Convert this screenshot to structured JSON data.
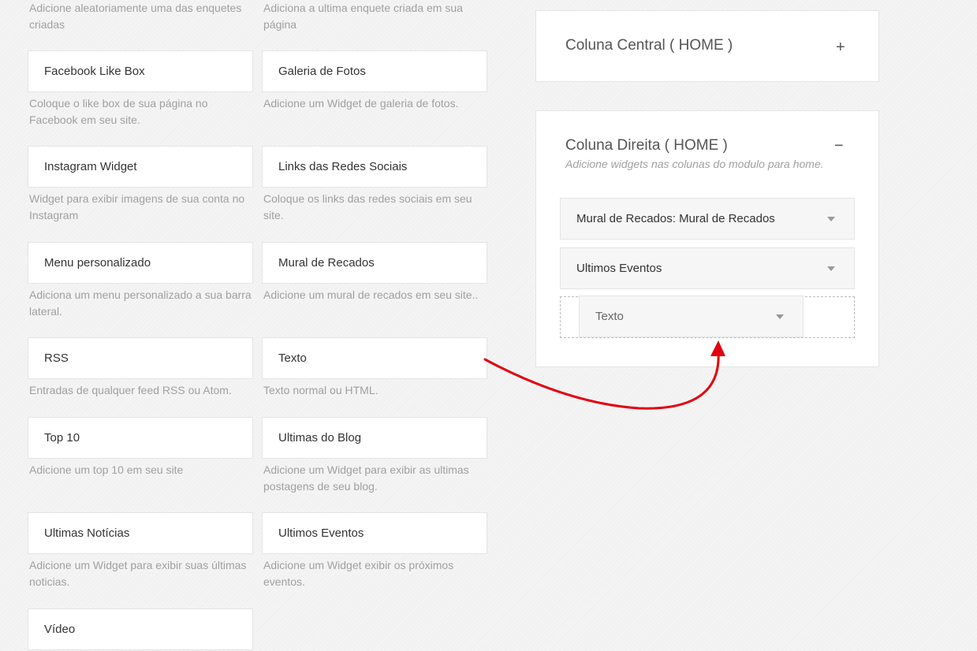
{
  "available_widgets": [
    {
      "label": "",
      "desc": "Adicione aleatoriamente uma das enquetes criadas"
    },
    {
      "label": "",
      "desc": "Adiciona a ultima enquete criada em sua página"
    },
    {
      "label": "Facebook Like Box",
      "desc": "Coloque o like box de sua página no Facebook em seu site."
    },
    {
      "label": "Galeria de Fotos",
      "desc": "Adicione um Widget de galeria de fotos."
    },
    {
      "label": "Instagram Widget",
      "desc": "Widget para exibir imagens de sua conta no Instagram"
    },
    {
      "label": "Links das Redes Sociais",
      "desc": "Coloque os links das redes sociais em seu site."
    },
    {
      "label": "Menu personalizado",
      "desc": "Adiciona um menu personalizado a sua barra lateral."
    },
    {
      "label": "Mural de Recados",
      "desc": "Adicione um mural de recados em seu site.."
    },
    {
      "label": "RSS",
      "desc": "Entradas de qualquer feed RSS ou Atom."
    },
    {
      "label": "Texto",
      "desc": "Texto normal ou HTML."
    },
    {
      "label": "Top 10",
      "desc": "Adicione um top 10 em seu site"
    },
    {
      "label": "Ultimas do Blog",
      "desc": "Adicione um Widget para exibir as ultimas postagens de seu blog."
    },
    {
      "label": "Ultimas Notícias",
      "desc": "Adicione um Widget para exibir suas últimas noticias."
    },
    {
      "label": "Ultimos Eventos",
      "desc": "Adicione um Widget exibir os próximos eventos."
    },
    {
      "label": "Vídeo",
      "desc": ""
    }
  ],
  "sidebars": {
    "central": {
      "title": "Coluna Central ( HOME )",
      "toggle": "+"
    },
    "direita": {
      "title": "Coluna Direita ( HOME )",
      "toggle": "−",
      "description": "Adicione widgets nas colunas do modulo para home.",
      "widgets": [
        {
          "label": "Mural de Recados: Mural de Recados"
        },
        {
          "label": "Ultimos Eventos"
        }
      ],
      "dragging": {
        "label": "Texto"
      }
    }
  },
  "colors": {
    "arrow": "#e3000f",
    "border": "#e4e4e4",
    "muted_text": "#a0a0a0"
  }
}
